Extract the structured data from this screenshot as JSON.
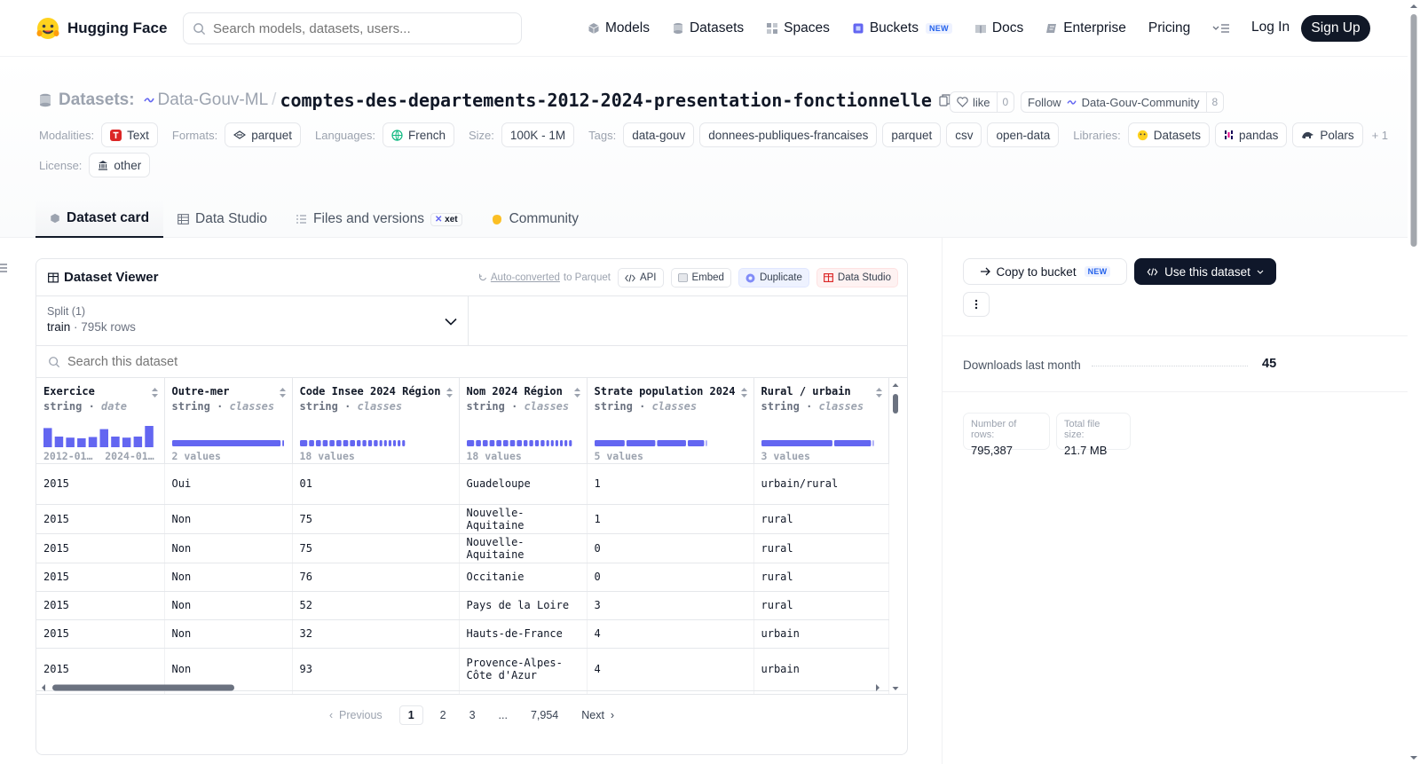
{
  "nav": {
    "brand": "Hugging Face",
    "search_placeholder": "Search models, datasets, users...",
    "links": [
      {
        "label": "Models",
        "icon": "cube-icon"
      },
      {
        "label": "Datasets",
        "icon": "database-icon"
      },
      {
        "label": "Spaces",
        "icon": "grid-icon"
      },
      {
        "label": "Buckets",
        "icon": "bucket-icon",
        "badge": "NEW"
      },
      {
        "label": "Docs",
        "icon": "book-icon"
      },
      {
        "label": "Enterprise",
        "icon": "enterprise-icon"
      },
      {
        "label": "Pricing"
      }
    ],
    "login": "Log In",
    "signup": "Sign Up"
  },
  "header": {
    "section_label": "Datasets:",
    "org": "Data-Gouv-ML",
    "repo": "comptes-des-departements-2012-2024-presentation-fonctionnelle",
    "like_label": "like",
    "like_count": "0",
    "follow_label": "Follow",
    "follow_org": "Data-Gouv-Community",
    "follow_count": "8"
  },
  "tags": {
    "modalities_label": "Modalities:",
    "modalities": [
      "Text"
    ],
    "formats_label": "Formats:",
    "formats": [
      "parquet"
    ],
    "languages_label": "Languages:",
    "languages": [
      "French"
    ],
    "size_label": "Size:",
    "size": "100K - 1M",
    "tags_label": "Tags:",
    "tags": [
      "data-gouv",
      "donnees-publiques-francaises",
      "parquet",
      "csv",
      "open-data"
    ],
    "libraries_label": "Libraries:",
    "libraries": [
      "Datasets",
      "pandas",
      "Polars"
    ],
    "libraries_more": "+ 1",
    "license_label": "License:",
    "license": "other"
  },
  "tabs": [
    {
      "label": "Dataset card",
      "icon": "cube-icon",
      "active": true
    },
    {
      "label": "Data Studio",
      "icon": "table-icon"
    },
    {
      "label": "Files and versions",
      "icon": "files-icon",
      "badge": "xet"
    },
    {
      "label": "Community",
      "icon": "community-icon"
    }
  ],
  "viewer": {
    "title": "Dataset Viewer",
    "autoconv_link": "Auto-converted",
    "autoconv_rest": "to Parquet",
    "actions": [
      "API",
      "Embed",
      "Duplicate",
      "Data Studio"
    ],
    "split_label": "Split (1)",
    "split_name": "train",
    "split_rows": "795k rows",
    "search_placeholder": "Search this dataset",
    "columns": [
      {
        "name": "Exercice",
        "type": "string",
        "kind": "date",
        "footer": "2012-01…",
        "footer2": "2024-01…",
        "viz": "histogram"
      },
      {
        "name": "Outre-mer",
        "type": "string",
        "kind": "classes",
        "footer": "2 values",
        "viz": "classes"
      },
      {
        "name": "Code Insee 2024 Région",
        "type": "string",
        "kind": "classes",
        "footer": "18 values",
        "viz": "classes"
      },
      {
        "name": "Nom 2024 Région",
        "type": "string",
        "kind": "classes",
        "footer": "18 values",
        "viz": "classes"
      },
      {
        "name": "Strate population 2024",
        "type": "string",
        "kind": "classes",
        "footer": "5 values",
        "viz": "classes"
      },
      {
        "name": "Rural / urbain",
        "type": "string",
        "kind": "classes",
        "footer": "3 values",
        "viz": "classes"
      }
    ],
    "histogram": [
      0.9,
      0.5,
      0.45,
      0.42,
      0.48,
      0.85,
      0.5,
      0.45,
      0.5,
      1.0
    ],
    "class_segments": [
      [
        0.97,
        0.03
      ],
      [
        0.08,
        0.06,
        0.06,
        0.06,
        0.06,
        0.06,
        0.06,
        0.06,
        0.05,
        0.05,
        0.05,
        0.05,
        0.04,
        0.04,
        0.04,
        0.04,
        0.04,
        0.04
      ],
      [
        0.08,
        0.06,
        0.06,
        0.06,
        0.06,
        0.06,
        0.06,
        0.06,
        0.05,
        0.05,
        0.05,
        0.05,
        0.04,
        0.04,
        0.04,
        0.04,
        0.04,
        0.04
      ],
      [
        0.28,
        0.27,
        0.27,
        0.16,
        0.02
      ],
      [
        0.64,
        0.34,
        0.02
      ]
    ],
    "rows": [
      [
        "2015",
        "Oui",
        "01",
        "Guadeloupe",
        "1",
        "urbain/rural"
      ],
      [
        "2015",
        "Non",
        "75",
        "Nouvelle-Aquitaine",
        "1",
        "rural"
      ],
      [
        "2015",
        "Non",
        "75",
        "Nouvelle-Aquitaine",
        "0",
        "rural"
      ],
      [
        "2015",
        "Non",
        "76",
        "Occitanie",
        "0",
        "rural"
      ],
      [
        "2015",
        "Non",
        "52",
        "Pays de la Loire",
        "3",
        "rural"
      ],
      [
        "2015",
        "Non",
        "32",
        "Hauts-de-France",
        "4",
        "urbain"
      ],
      [
        "2015",
        "Non",
        "93",
        "Provence-Alpes-Côte d'Azur",
        "4",
        "urbain"
      ]
    ],
    "pager": {
      "prev": "Previous",
      "pages": [
        "1",
        "2",
        "3",
        "...",
        "7,954"
      ],
      "next": "Next"
    }
  },
  "sidebar": {
    "copy_label": "Copy to bucket",
    "copy_badge": "NEW",
    "use_label": "Use this dataset",
    "downloads_label": "Downloads last month",
    "downloads_value": "45",
    "rows_label": "Number of rows:",
    "rows_value": "795,387",
    "size_label": "Total file size:",
    "size_value": "21.7 MB"
  },
  "colors": {
    "accent": "#6366f1",
    "accent_light": "#a5b4fc",
    "dark": "#0f172a"
  }
}
